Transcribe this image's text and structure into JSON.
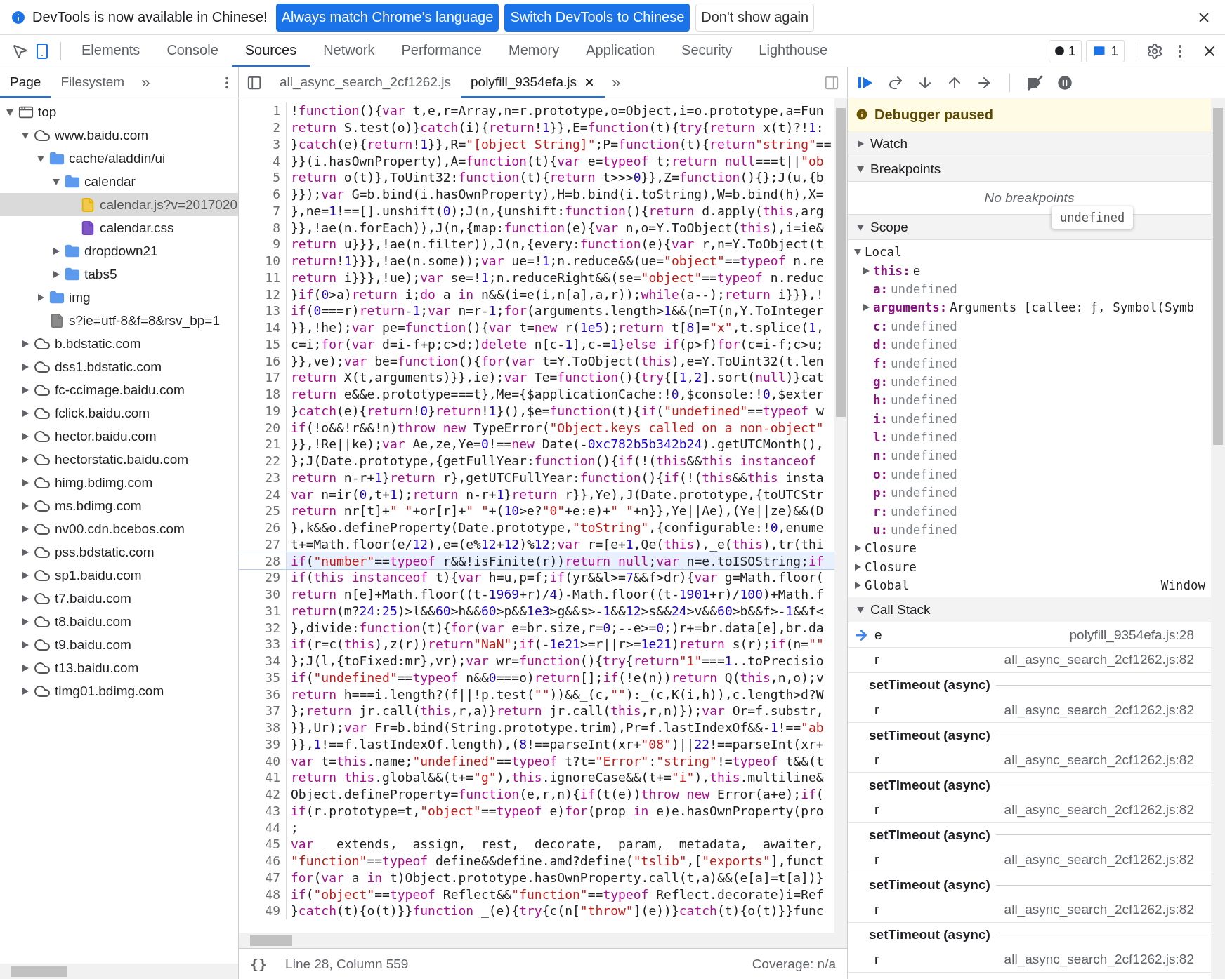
{
  "infobar": {
    "message": "DevTools is now available in Chinese!",
    "buttons": [
      {
        "label": "Always match Chrome's language",
        "kind": "primary"
      },
      {
        "label": "Switch DevTools to Chinese",
        "kind": "primary"
      },
      {
        "label": "Don't show again",
        "kind": "secondary"
      }
    ]
  },
  "panel_tabs": [
    {
      "label": "Elements",
      "selected": false
    },
    {
      "label": "Console",
      "selected": false
    },
    {
      "label": "Sources",
      "selected": true
    },
    {
      "label": "Network",
      "selected": false
    },
    {
      "label": "Performance",
      "selected": false
    },
    {
      "label": "Memory",
      "selected": false
    },
    {
      "label": "Application",
      "selected": false
    },
    {
      "label": "Security",
      "selected": false
    },
    {
      "label": "Lighthouse",
      "selected": false
    }
  ],
  "status_badges": [
    {
      "kind": "errors",
      "count": "1"
    },
    {
      "kind": "messages",
      "count": "1"
    }
  ],
  "navigator": {
    "tabs": [
      {
        "label": "Page",
        "selected": true
      },
      {
        "label": "Filesystem",
        "selected": false
      }
    ],
    "more": "»",
    "tree": [
      {
        "label": "top",
        "kind": "frame",
        "expanded": true,
        "selected": false,
        "children": [
          {
            "label": "www.baidu.com",
            "kind": "domain",
            "expanded": true,
            "selected": false,
            "children": [
              {
                "label": "cache/aladdin/ui",
                "kind": "folder",
                "expanded": true,
                "selected": false,
                "children": [
                  {
                    "label": "calendar",
                    "kind": "folder",
                    "expanded": true,
                    "selected": false,
                    "children": [
                      {
                        "label": "calendar.js?v=2017020",
                        "kind": "script",
                        "selected": true
                      },
                      {
                        "label": "calendar.css",
                        "kind": "stylesheet",
                        "selected": false
                      }
                    ]
                  },
                  {
                    "label": "dropdown21",
                    "kind": "folder",
                    "expanded": false,
                    "selected": false
                  },
                  {
                    "label": "tabs5",
                    "kind": "folder",
                    "expanded": false,
                    "selected": false
                  }
                ]
              },
              {
                "label": "img",
                "kind": "folder",
                "expanded": false,
                "selected": false
              },
              {
                "label": "s?ie=utf-8&f=8&rsv_bp=1",
                "kind": "document",
                "selected": false
              }
            ]
          },
          {
            "label": "b.bdstatic.com",
            "kind": "domain",
            "expanded": false,
            "selected": false
          },
          {
            "label": "dss1.bdstatic.com",
            "kind": "domain",
            "expanded": false,
            "selected": false
          },
          {
            "label": "fc-ccimage.baidu.com",
            "kind": "domain",
            "expanded": false,
            "selected": false
          },
          {
            "label": "fclick.baidu.com",
            "kind": "domain",
            "expanded": false,
            "selected": false
          },
          {
            "label": "hector.baidu.com",
            "kind": "domain",
            "expanded": false,
            "selected": false
          },
          {
            "label": "hectorstatic.baidu.com",
            "kind": "domain",
            "expanded": false,
            "selected": false
          },
          {
            "label": "himg.bdimg.com",
            "kind": "domain",
            "expanded": false,
            "selected": false
          },
          {
            "label": "ms.bdimg.com",
            "kind": "domain",
            "expanded": false,
            "selected": false
          },
          {
            "label": "nv00.cdn.bcebos.com",
            "kind": "domain",
            "expanded": false,
            "selected": false
          },
          {
            "label": "pss.bdstatic.com",
            "kind": "domain",
            "expanded": false,
            "selected": false
          },
          {
            "label": "sp1.baidu.com",
            "kind": "domain",
            "expanded": false,
            "selected": false
          },
          {
            "label": "t7.baidu.com",
            "kind": "domain",
            "expanded": false,
            "selected": false
          },
          {
            "label": "t8.baidu.com",
            "kind": "domain",
            "expanded": false,
            "selected": false
          },
          {
            "label": "t9.baidu.com",
            "kind": "domain",
            "expanded": false,
            "selected": false
          },
          {
            "label": "t13.baidu.com",
            "kind": "domain",
            "expanded": false,
            "selected": false
          },
          {
            "label": "timg01.bdimg.com",
            "kind": "domain",
            "expanded": false,
            "selected": false
          }
        ]
      }
    ]
  },
  "editor": {
    "tabs": [
      {
        "label": "all_async_search_2cf1262.js",
        "selected": false,
        "closable": false
      },
      {
        "label": "polyfill_9354efa.js",
        "selected": true,
        "closable": true
      }
    ],
    "more": "»",
    "lines": [
      {
        "number": "1",
        "text": "!function(){var t,e,r=Array,n=r.prototype,o=Object,i=o.prototype,a=Fun",
        "paused": false
      },
      {
        "number": "2",
        "text": "return S.test(o)}catch(i){return!1}},E=function(t){try{return x(t)?!1:",
        "paused": false
      },
      {
        "number": "3",
        "text": "}catch(e){return!1}},R=\"[object String]\";P=function(t){return\"string\"==",
        "paused": false
      },
      {
        "number": "4",
        "text": "}}(i.hasOwnProperty),A=function(t){var e=typeof t;return null===t||\"ob",
        "paused": false
      },
      {
        "number": "5",
        "text": "return o(t)},ToUint32:function(t){return t>>>0}},Z=function(){};J(u,{b",
        "paused": false
      },
      {
        "number": "6",
        "text": "}});var G=b.bind(i.hasOwnProperty),H=b.bind(i.toString),W=b.bind(h),X=",
        "paused": false
      },
      {
        "number": "7",
        "text": "},ne=1!==[].unshift(0);J(n,{unshift:function(){return d.apply(this,arg",
        "paused": false
      },
      {
        "number": "8",
        "text": "}},!ae(n.forEach)),J(n,{map:function(e){var n,o=Y.ToObject(this),i=ie&",
        "paused": false
      },
      {
        "number": "9",
        "text": "return u}}},!ae(n.filter)),J(n,{every:function(e){var r,n=Y.ToObject(t",
        "paused": false
      },
      {
        "number": "10",
        "text": "return!1}}},!ae(n.some));var ue=!1;n.reduce&&(ue=\"object\"==typeof n.re",
        "paused": false
      },
      {
        "number": "11",
        "text": "return i}}},!ue);var se=!1;n.reduceRight&&(se=\"object\"==typeof n.reduc",
        "paused": false
      },
      {
        "number": "12",
        "text": "}if(0>a)return i;do a in n&&(i=e(i,n[a],a,r));while(a--);return i}}},!",
        "paused": false
      },
      {
        "number": "13",
        "text": "if(0===r)return-1;var n=r-1;for(arguments.length>1&&(n=T(n,Y.ToInteger",
        "paused": false
      },
      {
        "number": "14",
        "text": "}},!he);var pe=function(){var t=new r(1e5);return t[8]=\"x\",t.splice(1,",
        "paused": false
      },
      {
        "number": "15",
        "text": "c=i;for(var d=i-f+p;c>d;)delete n[c-1],c-=1}else if(p>f)for(c=i-f;c>u;",
        "paused": false
      },
      {
        "number": "16",
        "text": "}},ve);var be=function(){for(var t=Y.ToObject(this),e=Y.ToUint32(t.len",
        "paused": false
      },
      {
        "number": "17",
        "text": "return X(t,arguments)}},ie);var Te=function(){try{[1,2].sort(null)}cat",
        "paused": false
      },
      {
        "number": "18",
        "text": "return e&&e.prototype===t},Me={$applicationCache:!0,$console:!0,$exter",
        "paused": false
      },
      {
        "number": "19",
        "text": "}catch(e){return!0}return!1}(),$e=function(t){if(\"undefined\"==typeof w",
        "paused": false
      },
      {
        "number": "20",
        "text": "if(!o&&!r&&!n)throw new TypeError(\"Object.keys called on a non-object\"",
        "paused": false
      },
      {
        "number": "21",
        "text": "}},!Re||ke);var Ae,ze,Ye=0!==new Date(-0xc782b5b342b24).getUTCMonth(),",
        "paused": false
      },
      {
        "number": "22",
        "text": "};J(Date.prototype,{getFullYear:function(){if(!(this&&this instanceof",
        "paused": false
      },
      {
        "number": "23",
        "text": "return n-r+1}return r},getUTCFullYear:function(){if(!(this&&this insta",
        "paused": false
      },
      {
        "number": "24",
        "text": "var n=ir(0,t+1);return n-r+1}return r}},Ye),J(Date.prototype,{toUTCStr",
        "paused": false
      },
      {
        "number": "25",
        "text": "return nr[t]+\" \"+or[r]+\" \"+(10>e?\"0\"+e:e)+\" \"+n}},Ye||Ae),(Ye||ze)&&(D",
        "paused": false
      },
      {
        "number": "26",
        "text": "},k&&o.defineProperty(Date.prototype,\"toString\",{configurable:!0,enume",
        "paused": false
      },
      {
        "number": "27",
        "text": "t+=Math.floor(e/12),e=(e%12+12)%12;var r=[e+1,Qe(this),_e(this),tr(thi",
        "paused": false
      },
      {
        "number": "28",
        "text": "if(\"number\"==typeof r&&!isFinite(r))return null;var n=e.toISOString;if",
        "paused": true
      },
      {
        "number": "29",
        "text": "if(this instanceof t){var h=u,p=f;if(yr&&l>=7&&f>dr){var g=Math.floor(",
        "paused": false
      },
      {
        "number": "30",
        "text": "return n[e]+Math.floor((t-1969+r)/4)-Math.floor((t-1901+r)/100)+Math.f",
        "paused": false
      },
      {
        "number": "31",
        "text": "return(m?24:25)>l&&60>h&&60>p&&1e3>g&&s>-1&&12>s&&24>v&&60>b&&f>-1&&f<",
        "paused": false
      },
      {
        "number": "32",
        "text": "},divide:function(t){for(var e=br.size,r=0;--e>=0;)r+=br.data[e],br.da",
        "paused": false
      },
      {
        "number": "33",
        "text": "if(r=c(this),z(r))return\"NaN\";if(-1e21>=r||r>=1e21)return s(r);if(n=\"\"",
        "paused": false
      },
      {
        "number": "34",
        "text": "};J(l,{toFixed:mr},vr);var wr=function(){try{return\"1\"===1..toPrecisio",
        "paused": false
      },
      {
        "number": "35",
        "text": "if(\"undefined\"==typeof n&&0===o)return[];if(!e(n))return Q(this,n,o);v",
        "paused": false
      },
      {
        "number": "36",
        "text": "return h===i.length?(f||!p.test(\"\"))&&_(c,\"\"):_(c,K(i,h)),c.length>d?W",
        "paused": false
      },
      {
        "number": "37",
        "text": "};return jr.call(this,r,a)}return jr.call(this,r,n)});var Or=f.substr,",
        "paused": false
      },
      {
        "number": "38",
        "text": "}},Ur);var Fr=b.bind(String.prototype.trim),Pr=f.lastIndexOf&&-1!==\"ab",
        "paused": false
      },
      {
        "number": "39",
        "text": "}},1!==f.lastIndexOf.length),(8!==parseInt(xr+\"08\")||22!==parseInt(xr+",
        "paused": false
      },
      {
        "number": "40",
        "text": "var t=this.name;\"undefined\"==typeof t?t=\"Error\":\"string\"!=typeof t&&(t",
        "paused": false
      },
      {
        "number": "41",
        "text": "return this.global&&(t+=\"g\"),this.ignoreCase&&(t+=\"i\"),this.multiline&",
        "paused": false
      },
      {
        "number": "42",
        "text": "Object.defineProperty=function(e,r,n){if(t(e))throw new Error(a+e);if(",
        "paused": false
      },
      {
        "number": "43",
        "text": "if(r.prototype=t,\"object\"==typeof e)for(prop in e)e.hasOwnProperty(pro",
        "paused": false
      },
      {
        "number": "44",
        "text": ";",
        "paused": false
      },
      {
        "number": "45",
        "text": "var __extends,__assign,__rest,__decorate,__param,__metadata,__awaiter,",
        "paused": false
      },
      {
        "number": "46",
        "text": "\"function\"==typeof define&&define.amd?define(\"tslib\",[\"exports\"],funct",
        "paused": false
      },
      {
        "number": "47",
        "text": "for(var a in t)Object.prototype.hasOwnProperty.call(t,a)&&(e[a]=t[a])}",
        "paused": false
      },
      {
        "number": "48",
        "text": "if(\"object\"==typeof Reflect&&\"function\"==typeof Reflect.decorate)i=Ref",
        "paused": false
      },
      {
        "number": "49",
        "text": "}catch(t){o(t)}}function _(e){try{c(n[\"throw\"](e))}catch(t){o(t)}}func",
        "paused": false
      }
    ],
    "status": {
      "format": "{}",
      "position": "Line 28, Column 559",
      "coverage": "Coverage: n/a"
    }
  },
  "debugger": {
    "paused_message": "Debugger paused",
    "watch": {
      "label": "Watch",
      "expanded": false
    },
    "breakpoints": {
      "label": "Breakpoints",
      "expanded": true,
      "empty_message": "No breakpoints"
    },
    "scope": {
      "label": "Scope",
      "expanded": true,
      "tooltip": "undefined",
      "groups": [
        {
          "label": "Local",
          "expanded": true,
          "variables": [
            {
              "name": "this:",
              "value": "e",
              "kind": "object",
              "expanded": false
            },
            {
              "name": "a:",
              "value": "undefined",
              "kind": "primitive"
            },
            {
              "name": "arguments:",
              "value": "Arguments [callee: ƒ, Symbol(Symb",
              "kind": "object",
              "expanded": false
            },
            {
              "name": "c:",
              "value": "undefined",
              "kind": "primitive"
            },
            {
              "name": "d:",
              "value": "undefined",
              "kind": "primitive"
            },
            {
              "name": "f:",
              "value": "undefined",
              "kind": "primitive"
            },
            {
              "name": "g:",
              "value": "undefined",
              "kind": "primitive"
            },
            {
              "name": "h:",
              "value": "undefined",
              "kind": "primitive"
            },
            {
              "name": "i:",
              "value": "undefined",
              "kind": "primitive"
            },
            {
              "name": "l:",
              "value": "undefined",
              "kind": "primitive"
            },
            {
              "name": "n:",
              "value": "undefined",
              "kind": "primitive"
            },
            {
              "name": "o:",
              "value": "undefined",
              "kind": "primitive"
            },
            {
              "name": "p:",
              "value": "undefined",
              "kind": "primitive"
            },
            {
              "name": "r:",
              "value": "undefined",
              "kind": "primitive"
            },
            {
              "name": "u:",
              "value": "undefined",
              "kind": "primitive"
            }
          ]
        },
        {
          "label": "Closure",
          "expanded": false
        },
        {
          "label": "Closure",
          "expanded": false
        },
        {
          "label": "Global",
          "expanded": false,
          "value": "Window"
        }
      ]
    },
    "call_stack": {
      "label": "Call Stack",
      "expanded": true,
      "frames": [
        {
          "kind": "frame",
          "function": "e",
          "location": "polyfill_9354efa.js:28",
          "current": true
        },
        {
          "kind": "frame",
          "function": "r",
          "location": "all_async_search_2cf1262.js:82",
          "current": false
        },
        {
          "kind": "async",
          "label": "setTimeout (async)"
        },
        {
          "kind": "frame",
          "function": "r",
          "location": "all_async_search_2cf1262.js:82",
          "current": false
        },
        {
          "kind": "async",
          "label": "setTimeout (async)"
        },
        {
          "kind": "frame",
          "function": "r",
          "location": "all_async_search_2cf1262.js:82",
          "current": false
        },
        {
          "kind": "async",
          "label": "setTimeout (async)"
        },
        {
          "kind": "frame",
          "function": "r",
          "location": "all_async_search_2cf1262.js:82",
          "current": false
        },
        {
          "kind": "async",
          "label": "setTimeout (async)"
        },
        {
          "kind": "frame",
          "function": "r",
          "location": "all_async_search_2cf1262.js:82",
          "current": false
        },
        {
          "kind": "async",
          "label": "setTimeout (async)"
        },
        {
          "kind": "frame",
          "function": "r",
          "location": "all_async_search_2cf1262.js:82",
          "current": false
        },
        {
          "kind": "async",
          "label": "setTimeout (async)"
        },
        {
          "kind": "frame",
          "function": "r",
          "location": "all_async_search_2cf1262.js:82",
          "current": false
        }
      ]
    }
  }
}
